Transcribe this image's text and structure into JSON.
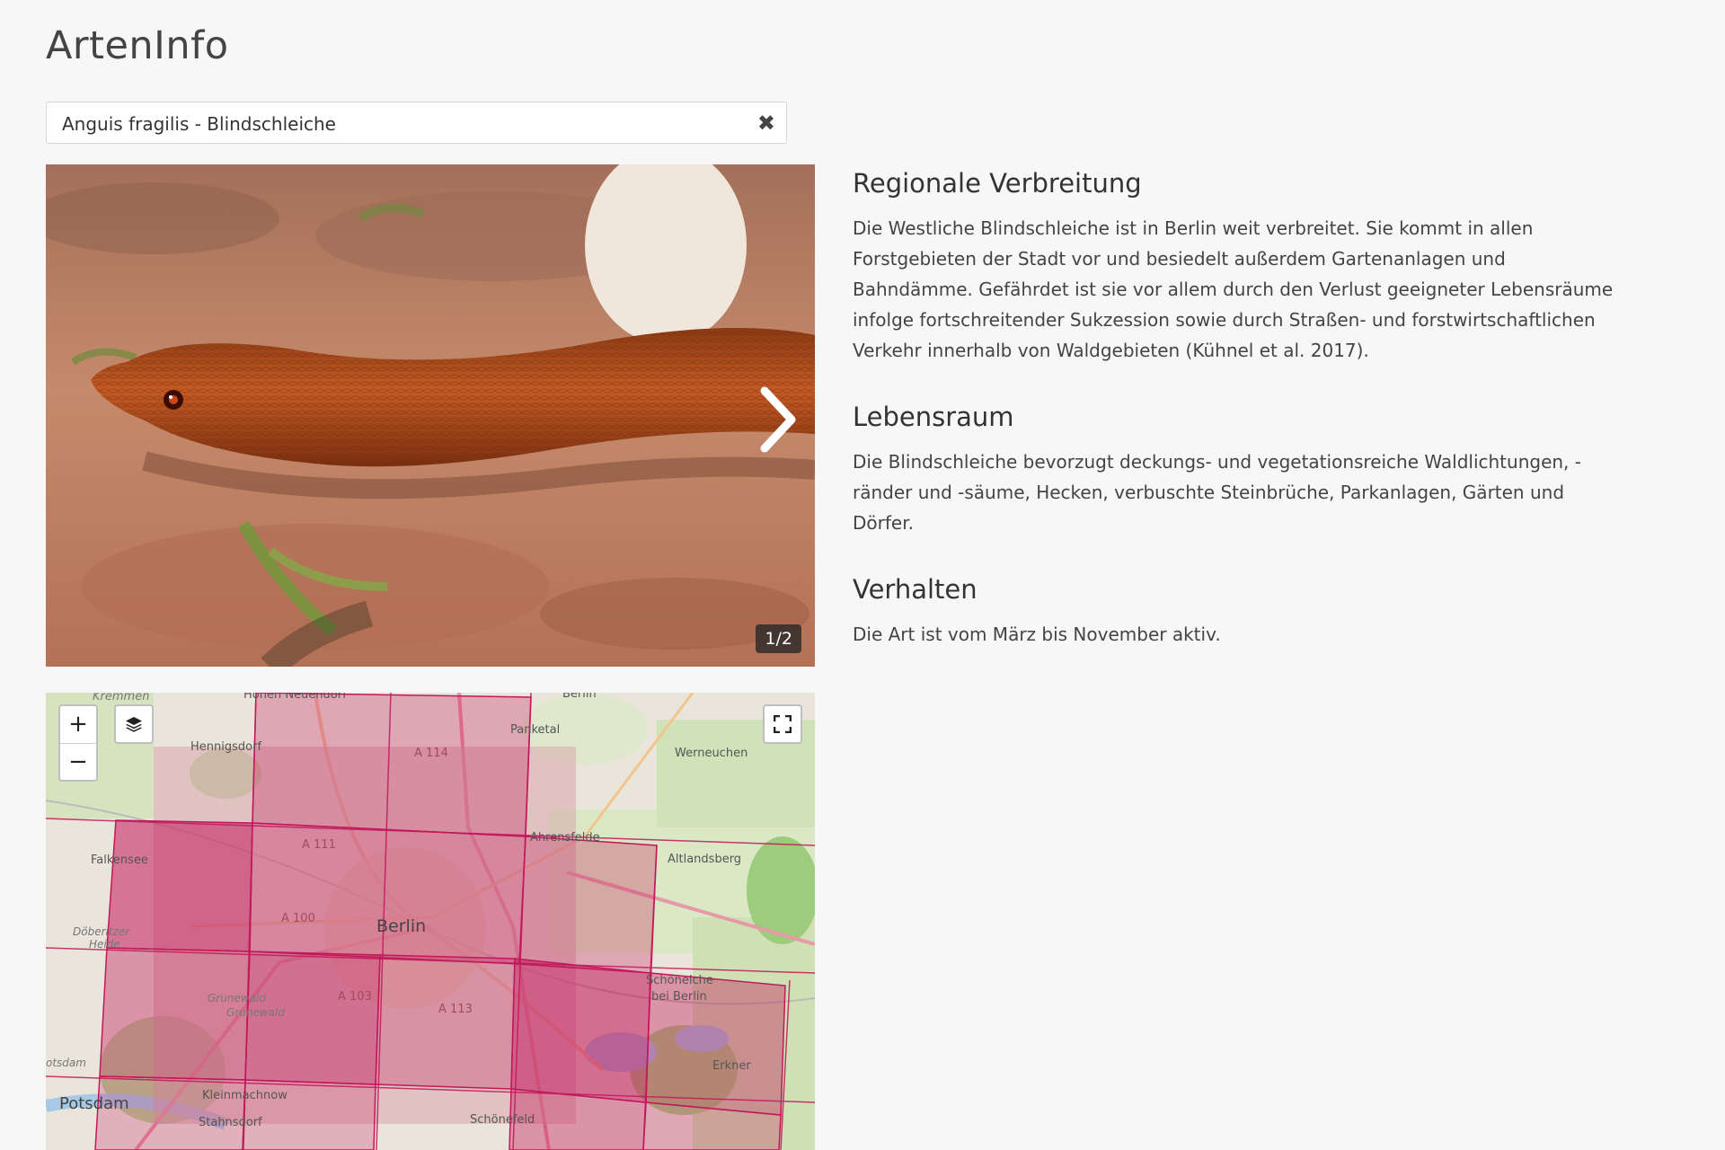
{
  "app": {
    "title": "ArtenInfo"
  },
  "species_select": {
    "value": "Anguis fragilis - Blindschleiche",
    "clear_glyph": "✖"
  },
  "gallery": {
    "counter": "1/2",
    "current": 1,
    "total": 2
  },
  "map": {
    "zoom_in": "+",
    "zoom_out": "−",
    "labels": {
      "kremmen": "Kremmen",
      "hohen_neuendorf": "Hohen Neuendorf",
      "berlin_top": "Berlin",
      "panketal": "Panketal",
      "hennigsdorf": "Hennigsdorf",
      "a114": "A 114",
      "werneuchen": "Werneuchen",
      "a111": "A 111",
      "ahrensfelde": "Ahrensfelde",
      "altlandsberg": "Altlandsberg",
      "falkensee": "Falkensee",
      "a100": "A 100",
      "berlin": "Berlin",
      "doberitzer": "Döberitzer",
      "heide": "Heide",
      "schoeneiche": "Schöneiche",
      "bei_berlin": "bei Berlin",
      "grunewald1": "Grunewald",
      "grunewald2": "Grunewald",
      "a103": "A 103",
      "a113": "A 113",
      "erkner": "Erkner",
      "potsdam_small": "otsdam",
      "kleinmachnow": "Kleinmachnow",
      "potsdam": "Potsdam",
      "stahnsdorf": "Stahnsdorf",
      "schoenefeld": "Schönefeld"
    }
  },
  "sections": [
    {
      "heading": "Regionale Verbreitung",
      "text": "Die Westliche Blindschleiche ist in Berlin weit verbreitet. Sie kommt in allen Forstgebieten der Stadt vor und besiedelt außerdem Gartenanlagen und Bahndämme. Gefährdet ist sie vor allem durch den Verlust geeigneter Lebensräume infolge fortschreitender Sukzession sowie durch Straßen- und forstwirtschaftlichen Verkehr innerhalb von Waldgebieten (Kühnel et al. 2017)."
    },
    {
      "heading": "Lebensraum",
      "text": "Die Blindschleiche bevorzugt deckungs- und vegetationsreiche Waldlichtungen, -ränder und -säume, Hecken, verbuschte Steinbrüche, Parkanlagen, Gärten und Dörfer."
    },
    {
      "heading": "Verhalten",
      "text": "Die Art ist vom März bis November aktiv."
    }
  ],
  "colors": {
    "grid_fill": "#c2185b",
    "grid_stroke": "#c2185b"
  }
}
